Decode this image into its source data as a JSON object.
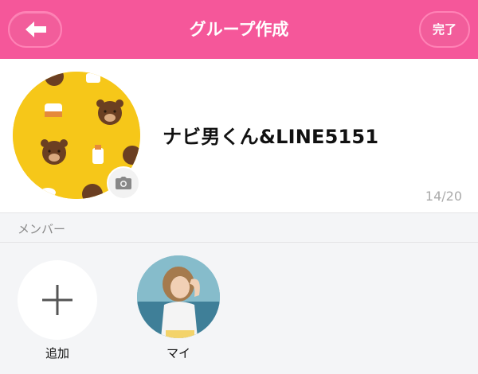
{
  "header": {
    "title": "グループ作成",
    "done_label": "完了",
    "back_icon": "arrow-left-icon",
    "background": "#f5579a"
  },
  "profile": {
    "group_name": "ナビ男くん&LINE5151",
    "char_count": "14/20",
    "icon_background": "#f6c719",
    "camera_icon": "camera-icon"
  },
  "members_section": {
    "label": "メンバー"
  },
  "members": {
    "add_label": "追加",
    "items": [
      {
        "name": "マイ"
      }
    ]
  }
}
